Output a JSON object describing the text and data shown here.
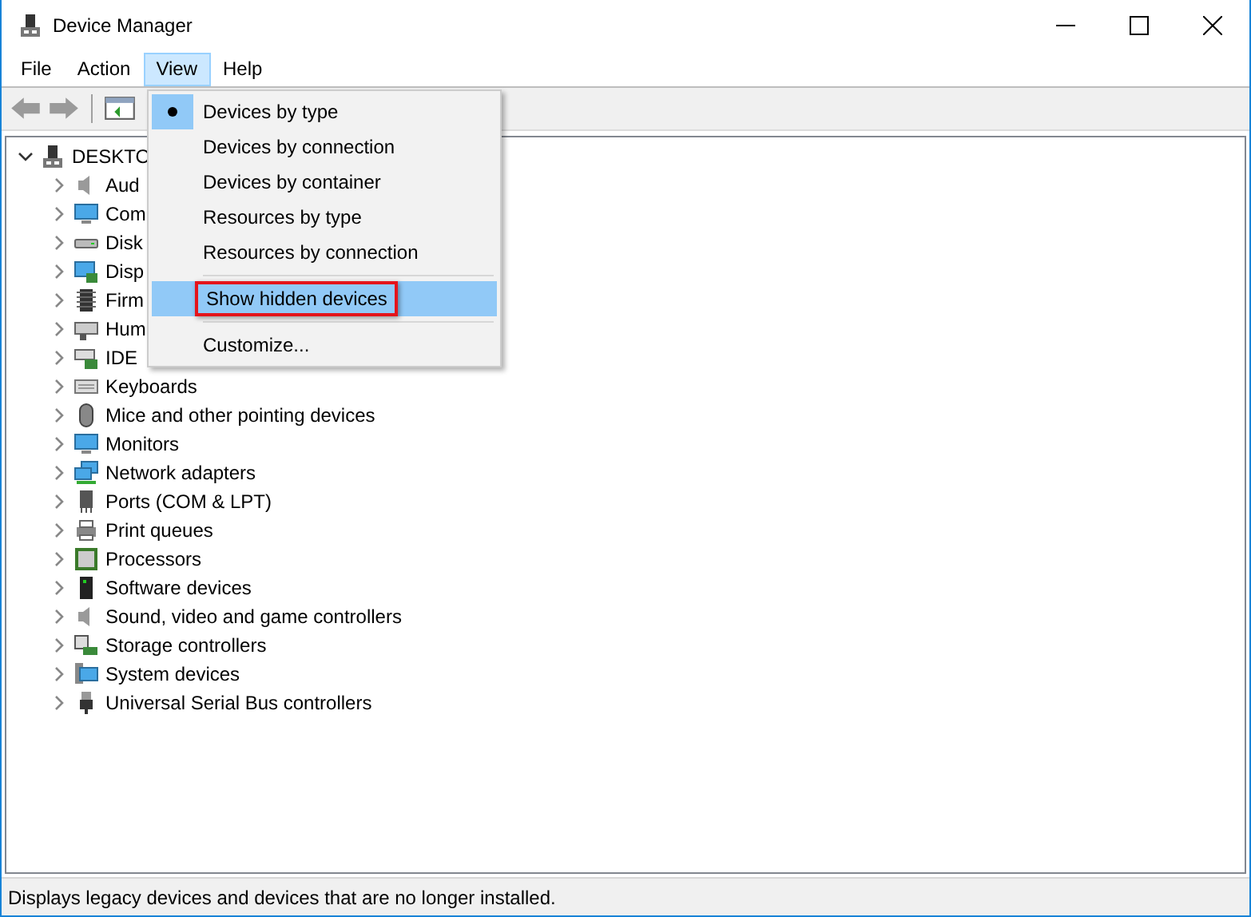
{
  "window": {
    "title": "Device Manager"
  },
  "menu_bar": [
    {
      "label": "File",
      "selected": false
    },
    {
      "label": "Action",
      "selected": false
    },
    {
      "label": "View",
      "selected": true
    },
    {
      "label": "Help",
      "selected": false
    }
  ],
  "tree": {
    "label": "DESKTO",
    "expanded": true,
    "children": [
      {
        "label": "Aud",
        "expanded": false
      },
      {
        "label": "Com",
        "expanded": false
      },
      {
        "label": "Disk",
        "expanded": false
      },
      {
        "label": "Disp",
        "expanded": false
      },
      {
        "label": "Firm",
        "expanded": false
      },
      {
        "label": "Hum",
        "expanded": false
      },
      {
        "label": "IDE",
        "expanded": false
      },
      {
        "label": "Keyboards",
        "expanded": false
      },
      {
        "label": "Mice and other pointing devices",
        "expanded": false
      },
      {
        "label": "Monitors",
        "expanded": false
      },
      {
        "label": "Network adapters",
        "expanded": false
      },
      {
        "label": "Ports (COM & LPT)",
        "expanded": false
      },
      {
        "label": "Print queues",
        "expanded": false
      },
      {
        "label": "Processors",
        "expanded": false
      },
      {
        "label": "Software devices",
        "expanded": false
      },
      {
        "label": "Sound, video and game controllers",
        "expanded": false
      },
      {
        "label": "Storage controllers",
        "expanded": false
      },
      {
        "label": "System devices",
        "expanded": false
      },
      {
        "label": "Universal Serial Bus controllers",
        "expanded": false
      }
    ]
  },
  "view_menu": [
    {
      "kind": "item",
      "label": "Devices by type",
      "checked": true,
      "selected": false
    },
    {
      "kind": "item",
      "label": "Devices by connection",
      "checked": false,
      "selected": false
    },
    {
      "kind": "item",
      "label": "Devices by container",
      "checked": false,
      "selected": false
    },
    {
      "kind": "item",
      "label": "Resources by type",
      "checked": false,
      "selected": false
    },
    {
      "kind": "item",
      "label": "Resources by connection",
      "checked": false,
      "selected": false
    },
    {
      "kind": "separator"
    },
    {
      "kind": "item",
      "label": "Show hidden devices",
      "checked": false,
      "selected": true,
      "marked": true
    },
    {
      "kind": "separator"
    },
    {
      "kind": "item",
      "label": "Customize...",
      "checked": false,
      "selected": false
    }
  ],
  "status_bar": "Displays legacy devices and devices that are no longer installed."
}
